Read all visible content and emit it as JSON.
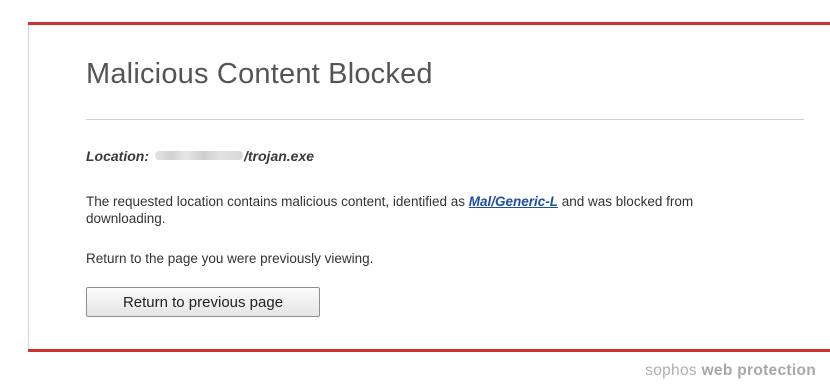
{
  "page": {
    "title": "Malicious Content Blocked",
    "location_label": "Location:",
    "location_path": "/trojan.exe",
    "message_before": "The requested location contains malicious content, identified as ",
    "threat_name": "Mal/Generic-L",
    "message_after": " and was blocked from downloading.",
    "return_text": "Return to the page you were previously viewing.",
    "return_button_label": "Return to previous page"
  },
  "footer": {
    "brand_light": "sophos",
    "brand_bold": "web protection"
  },
  "colors": {
    "accent_rule": "#d3312f",
    "link": "#1f4fa3",
    "footer_text": "#b0b0b0"
  }
}
